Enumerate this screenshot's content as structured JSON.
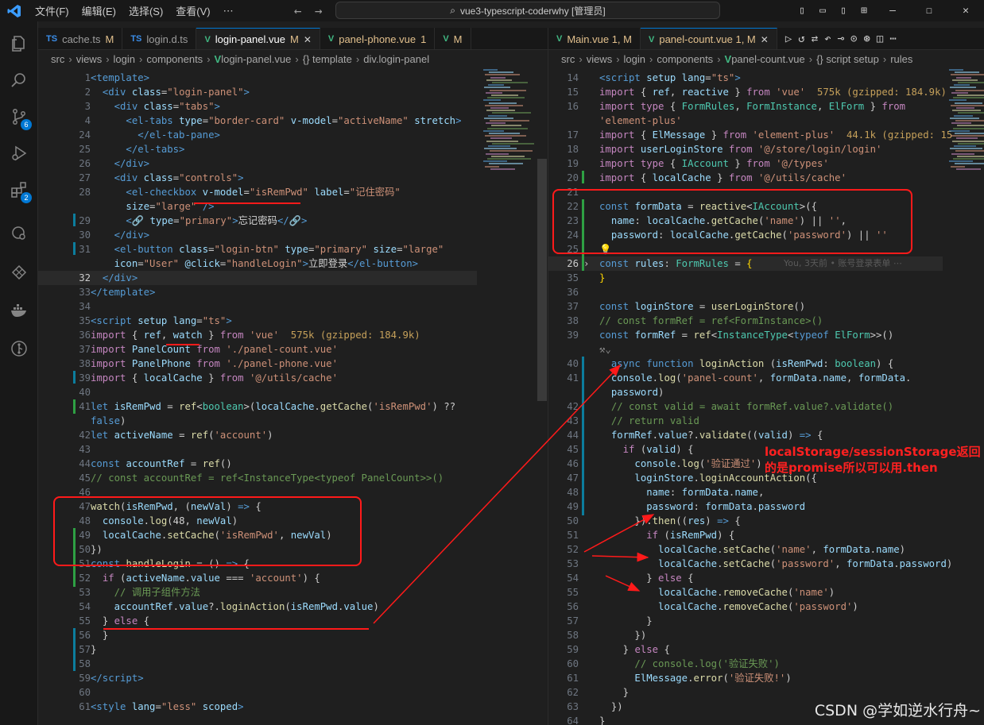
{
  "titlebar": {
    "menus": [
      "文件(F)",
      "编辑(E)",
      "选择(S)",
      "查看(V)",
      "⋯"
    ],
    "search": "vue3-typescript-coderwhy [管理员]"
  },
  "activity": {
    "scm_badge": "6",
    "extensions_badge": "2"
  },
  "left": {
    "tabs": [
      {
        "label": "cache.ts",
        "status": "M",
        "kind": "ts"
      },
      {
        "label": "login.d.ts",
        "status": "",
        "kind": "ts"
      },
      {
        "label": "login-panel.vue",
        "status": "M",
        "kind": "vue",
        "active": true
      },
      {
        "label": "panel-phone.vue",
        "status": "1",
        "kind": "vue"
      },
      {
        "label": "M",
        "status": "",
        "kind": "vue"
      }
    ],
    "breadcrumb": [
      "src",
      "views",
      "login",
      "components",
      "login-panel.vue",
      "{} template",
      "div.login-panel"
    ],
    "lines": [
      {
        "n": "1",
        "html": "<span class='tg'>&lt;template&gt;</span>"
      },
      {
        "n": "2",
        "html": "  <span class='tg'>&lt;div</span> <span class='at'>class</span><span class='pn'>=</span><span class='st'>\"login-panel\"</span><span class='tg'>&gt;</span>"
      },
      {
        "n": "3",
        "html": "    <span class='tg'>&lt;div</span> <span class='at'>class</span><span class='pn'>=</span><span class='st'>\"tabs\"</span><span class='tg'>&gt;</span>"
      },
      {
        "n": "4",
        "html": "      <span class='tg'>&lt;el-tabs</span> <span class='at'>type</span><span class='pn'>=</span><span class='st'>\"border-card\"</span> <span class='at'>v-model</span><span class='pn'>=</span><span class='st'>\"activeName\"</span> <span class='at'>stretch</span><span class='tg'>&gt;</span>"
      },
      {
        "n": "24",
        "html": "        <span class='tg'>&lt;/el-tab-pane&gt;</span>"
      },
      {
        "n": "25",
        "html": "      <span class='tg'>&lt;/el-tabs&gt;</span>"
      },
      {
        "n": "26",
        "html": "    <span class='tg'>&lt;/div&gt;</span>"
      },
      {
        "n": "27",
        "html": "    <span class='tg'>&lt;div</span> <span class='at'>class</span><span class='pn'>=</span><span class='st'>\"controls\"</span><span class='tg'>&gt;</span>"
      },
      {
        "n": "28",
        "html": "      <span class='tg'>&lt;el-checkbox</span> <span class='at'>v-model</span><span class='pn'>=</span><span class='st'>\"isRemPwd\"</span> <span class='at'>label</span><span class='pn'>=</span><span class='st'>\"记住密码\"</span>"
      },
      {
        "n": "",
        "html": "      <span class='at'>size</span><span class='pn'>=</span><span class='st'>\"large\"</span> <span class='tg'>/&gt;</span>"
      },
      {
        "n": "29",
        "html": "      <span class='tg'>&lt;🔗</span> <span class='at'>type</span><span class='pn'>=</span><span class='st'>\"primary\"</span><span class='tg'>&gt;</span><span class='wh'>忘记密码</span><span class='tg'>&lt;/🔗&gt;</span>"
      },
      {
        "n": "30",
        "html": "    <span class='tg'>&lt;/div&gt;</span>"
      },
      {
        "n": "31",
        "html": "    <span class='tg'>&lt;el-button</span> <span class='at'>class</span><span class='pn'>=</span><span class='st'>\"login-btn\"</span> <span class='at'>type</span><span class='pn'>=</span><span class='st'>\"primary\"</span> <span class='at'>size</span><span class='pn'>=</span><span class='st'>\"large\"</span>"
      },
      {
        "n": "",
        "html": "    <span class='at'>icon</span><span class='pn'>=</span><span class='st'>\"User\"</span> <span class='at'>@click</span><span class='pn'>=</span><span class='st'>\"handleLogin\"</span><span class='tg'>&gt;</span><span class='wh'>立即登录</span><span class='tg'>&lt;/el-button&gt;</span>"
      },
      {
        "n": "32",
        "html": "  <span class='tg'>&lt;/div&gt;</span>",
        "current": true
      },
      {
        "n": "33",
        "html": "<span class='tg'>&lt;/template&gt;</span>"
      },
      {
        "n": "34",
        "html": ""
      },
      {
        "n": "35",
        "html": "<span class='tg'>&lt;script</span> <span class='at'>setup</span> <span class='at'>lang</span><span class='pn'>=</span><span class='st'>\"ts\"</span><span class='tg'>&gt;</span>"
      },
      {
        "n": "36",
        "html": "<span class='kw'>import</span> <span class='pn'>{</span> <span class='va'>ref</span><span class='pn'>,</span> <span class='va'>watch</span> <span class='pn'>}</span> <span class='kw'>from</span> <span class='st'>'vue'</span>  <span class='sz'>575k (gzipped: 184.9k)</span>"
      },
      {
        "n": "37",
        "html": "<span class='kw'>import</span> <span class='va'>PanelCount</span> <span class='kw'>from</span> <span class='st'>'./panel-count.vue'</span>"
      },
      {
        "n": "38",
        "html": "<span class='kw'>import</span> <span class='va'>PanelPhone</span> <span class='kw'>from</span> <span class='st'>'./panel-phone.vue'</span>"
      },
      {
        "n": "39",
        "html": "<span class='kw'>import</span> <span class='pn'>{</span> <span class='va'>localCache</span> <span class='pn'>}</span> <span class='kw'>from</span> <span class='st'>'@/utils/cache'</span>"
      },
      {
        "n": "40",
        "html": ""
      },
      {
        "n": "41",
        "html": "<span class='sk'>let</span> <span class='va'>isRemPwd</span> <span class='pn'>=</span> <span class='fn'>ref</span><span class='pn'>&lt;</span><span class='ty'>boolean</span><span class='pn'>&gt;(</span><span class='va'>localCache</span><span class='pn'>.</span><span class='fn'>getCache</span><span class='pn'>(</span><span class='st'>'isRemPwd'</span><span class='pn'>) ??</span>"
      },
      {
        "n": "",
        "html": "<span class='bl'>false</span><span class='pn'>)</span>"
      },
      {
        "n": "42",
        "html": "<span class='sk'>let</span> <span class='va'>activeName</span> <span class='pn'>=</span> <span class='fn'>ref</span><span class='pn'>(</span><span class='st'>'account'</span><span class='pn'>)</span>"
      },
      {
        "n": "43",
        "html": ""
      },
      {
        "n": "44",
        "html": "<span class='sk'>const</span> <span class='va'>accountRef</span> <span class='pn'>=</span> <span class='fn'>ref</span><span class='pn'>()</span>"
      },
      {
        "n": "45",
        "html": "<span class='cm'>// const accountRef = ref&lt;InstanceType&lt;typeof PanelCount&gt;&gt;()</span>"
      },
      {
        "n": "46",
        "html": ""
      },
      {
        "n": "47",
        "html": "<span class='fn'>watch</span><span class='pn'>(</span><span class='va'>isRemPwd</span><span class='pn'>, (</span><span class='va'>newVal</span><span class='pn'>)</span> <span class='sk'>=&gt;</span> <span class='pn'>{</span>"
      },
      {
        "n": "48",
        "html": "  <span class='va'>console</span><span class='pn'>.</span><span class='fn'>log</span><span class='pn'>(</span><span class='wh'>48</span><span class='pn'>,</span> <span class='va'>newVal</span><span class='pn'>)</span>"
      },
      {
        "n": "49",
        "html": "  <span class='va'>localCache</span><span class='pn'>.</span><span class='fn'>setCache</span><span class='pn'>(</span><span class='st'>'isRemPwd'</span><span class='pn'>,</span> <span class='va'>newVal</span><span class='pn'>)</span>"
      },
      {
        "n": "50",
        "html": "<span class='pn'>})</span>"
      },
      {
        "n": "51",
        "html": "<span class='sk'>const</span> <span class='fn'>handleLogin</span> <span class='pn'>=</span> <span class='pn'>()</span> <span class='sk'>=&gt;</span> <span class='pn'>{</span>"
      },
      {
        "n": "52",
        "html": "  <span class='kw'>if</span> <span class='pn'>(</span><span class='va'>activeName</span><span class='pn'>.</span><span class='va'>value</span> <span class='pn'>===</span> <span class='st'>'account'</span><span class='pn'>) {</span>"
      },
      {
        "n": "53",
        "html": "    <span class='cm'>// 调用子组件方法</span>"
      },
      {
        "n": "54",
        "html": "    <span class='va'>accountRef</span><span class='pn'>.</span><span class='va'>value</span><span class='pn'>?.</span><span class='fn'>loginAction</span><span class='pn'>(</span><span class='va'>isRemPwd</span><span class='pn'>.</span><span class='va'>value</span><span class='pn'>)</span>"
      },
      {
        "n": "55",
        "html": "  <span class='pn'>}</span> <span class='kw'>else</span> <span class='pn'>{</span>"
      },
      {
        "n": "56",
        "html": "  <span class='pn'>}</span>"
      },
      {
        "n": "57",
        "html": "<span class='pn'>}</span>"
      },
      {
        "n": "58",
        "html": ""
      },
      {
        "n": "59",
        "html": "<span class='tg'>&lt;/script&gt;</span>"
      },
      {
        "n": "60",
        "html": ""
      },
      {
        "n": "61",
        "html": "<span class='tg'>&lt;style</span> <span class='at'>lang</span><span class='pn'>=</span><span class='st'>\"less\"</span> <span class='at'>scoped</span><span class='tg'>&gt;</span>"
      }
    ]
  },
  "right": {
    "tabs": [
      {
        "label": "Main.vue 1, M",
        "status": "",
        "kind": "vue"
      },
      {
        "label": "panel-count.vue 1, M",
        "status": "",
        "kind": "vue",
        "active": true
      }
    ],
    "breadcrumb": [
      "src",
      "views",
      "login",
      "components",
      "panel-count.vue",
      "{} script setup",
      "rules"
    ],
    "blame": "You, 3天前 • 账号登录表单 ⋯",
    "lines": [
      {
        "n": "14",
        "html": "<span class='tg'>&lt;script</span> <span class='at'>setup</span> <span class='at'>lang</span><span class='pn'>=</span><span class='st'>\"ts\"</span><span class='tg'>&gt;</span>"
      },
      {
        "n": "15",
        "html": "<span class='kw'>import</span> <span class='pn'>{</span> <span class='va'>ref</span><span class='pn'>,</span> <span class='va'>reactive</span> <span class='pn'>}</span> <span class='kw'>from</span> <span class='st'>'vue'</span>  <span class='sz'>575k (gzipped: 184.9k)</span>"
      },
      {
        "n": "16",
        "html": "<span class='kw'>import</span> <span class='kw'>type</span> <span class='pn'>{</span> <span class='ty'>FormRules</span><span class='pn'>,</span> <span class='ty'>FormInstance</span><span class='pn'>,</span> <span class='ty'>ElForm</span> <span class='pn'>}</span> <span class='kw'>from</span>"
      },
      {
        "n": "",
        "html": "<span class='st'>'element-plus'</span>"
      },
      {
        "n": "17",
        "html": "<span class='kw'>import</span> <span class='pn'>{</span> <span class='va'>ElMessage</span> <span class='pn'>}</span> <span class='kw'>from</span> <span class='st'>'element-plus'</span>  <span class='sz'>44.1k (gzipped: 15</span>"
      },
      {
        "n": "18",
        "html": "<span class='kw'>import</span> <span class='va'>userLoginStore</span> <span class='kw'>from</span> <span class='st'>'@/store/login/login'</span>"
      },
      {
        "n": "19",
        "html": "<span class='kw'>import</span> <span class='kw'>type</span> <span class='pn'>{</span> <span class='ty'>IAccount</span> <span class='pn'>}</span> <span class='kw'>from</span> <span class='st'>'@/types'</span>"
      },
      {
        "n": "20",
        "html": "<span class='kw'>import</span> <span class='pn'>{</span> <span class='va'>localCache</span> <span class='pn'>}</span> <span class='kw'>from</span> <span class='st'>'@/utils/cache'</span>"
      },
      {
        "n": "21",
        "html": ""
      },
      {
        "n": "22",
        "html": "<span class='sk'>const</span> <span class='va'>formData</span> <span class='pn'>=</span> <span class='fn'>reactive</span><span class='pn'>&lt;</span><span class='ty'>IAccount</span><span class='pn'>&gt;({</span>"
      },
      {
        "n": "23",
        "html": "  <span class='va'>name</span><span class='pn'>:</span> <span class='va'>localCache</span><span class='pn'>.</span><span class='fn'>getCache</span><span class='pn'>(</span><span class='st'>'name'</span><span class='pn'>) ||</span> <span class='st'>''</span><span class='pn'>,</span>"
      },
      {
        "n": "24",
        "html": "  <span class='va'>password</span><span class='pn'>:</span> <span class='va'>localCache</span><span class='pn'>.</span><span class='fn'>getCache</span><span class='pn'>(</span><span class='st'>'password'</span><span class='pn'>) ||</span> <span class='st'>''</span>"
      },
      {
        "n": "25",
        "html": "<span class='br'>💡</span>"
      },
      {
        "n": "26",
        "html": "<span class='sk'>const</span> <span class='va'>rules</span><span class='pn'>:</span> <span class='ty'>FormRules</span> <span class='pn'>=</span> <span class='br'>{</span>",
        "current": true,
        "fold": true
      },
      {
        "n": "35",
        "html": "<span class='br'>}</span>"
      },
      {
        "n": "36",
        "html": ""
      },
      {
        "n": "37",
        "html": "<span class='sk'>const</span> <span class='va'>loginStore</span> <span class='pn'>=</span> <span class='fn'>userLoginStore</span><span class='pn'>()</span>"
      },
      {
        "n": "38",
        "html": "<span class='cm'>// const formRef = ref&lt;FormInstance&gt;()</span>"
      },
      {
        "n": "39",
        "html": "<span class='sk'>const</span> <span class='va'>formRef</span> <span class='pn'>=</span> <span class='fn'>ref</span><span class='pn'>&lt;</span><span class='ty'>InstanceType</span><span class='pn'>&lt;</span><span class='sk'>typeof</span> <span class='ty'>ElForm</span><span class='pn'>&gt;&gt;()</span>"
      },
      {
        "n": "",
        "html": "<span class='gl'>⚒⌄</span>"
      },
      {
        "n": "40",
        "html": "  <span class='sk'>async</span> <span class='sk'>function</span> <span class='fn'>loginAction</span> <span class='pn'>(</span><span class='va'>isRemPwd</span><span class='pn'>:</span> <span class='ty'>boolean</span><span class='pn'>) {</span>"
      },
      {
        "n": "41",
        "html": "  <span class='va'>console</span><span class='pn'>.</span><span class='fn'>log</span><span class='pn'>(</span><span class='st'>'panel-count'</span><span class='pn'>,</span> <span class='va'>formData</span><span class='pn'>.</span><span class='va'>name</span><span class='pn'>,</span> <span class='va'>formData</span><span class='pn'>.</span>"
      },
      {
        "n": "",
        "html": "  <span class='va'>password</span><span class='pn'>)</span>"
      },
      {
        "n": "42",
        "html": "  <span class='cm'>// const valid = await formRef.value?.validate()</span>"
      },
      {
        "n": "43",
        "html": "  <span class='cm'>// return valid</span>"
      },
      {
        "n": "44",
        "html": "  <span class='va'>formRef</span><span class='pn'>.</span><span class='va'>value</span><span class='pn'>?.</span><span class='fn'>validate</span><span class='pn'>((</span><span class='va'>valid</span><span class='pn'>)</span> <span class='sk'>=&gt;</span> <span class='pn'>{</span>"
      },
      {
        "n": "45",
        "html": "    <span class='kw'>if</span> <span class='pn'>(</span><span class='va'>valid</span><span class='pn'>) {</span>"
      },
      {
        "n": "46",
        "html": "      <span class='va'>console</span><span class='pn'>.</span><span class='fn'>log</span><span class='pn'>(</span><span class='st'>'验证通过'</span><span class='pn'>)</span>"
      },
      {
        "n": "47",
        "html": "      <span class='va'>loginStore</span><span class='pn'>.</span><span class='fn'>loginAccountAction</span><span class='pn'>({</span>"
      },
      {
        "n": "48",
        "html": "        <span class='va'>name</span><span class='pn'>:</span> <span class='va'>formData</span><span class='pn'>.</span><span class='va'>name</span><span class='pn'>,</span>"
      },
      {
        "n": "49",
        "html": "        <span class='va'>password</span><span class='pn'>:</span> <span class='va'>formData</span><span class='pn'>.</span><span class='va'>password</span>"
      },
      {
        "n": "50",
        "html": "      <span class='pn'>}).</span><span class='fn'>then</span><span class='pn'>((</span><span class='va'>res</span><span class='pn'>)</span> <span class='sk'>=&gt;</span> <span class='pn'>{</span>"
      },
      {
        "n": "51",
        "html": "        <span class='kw'>if</span> <span class='pn'>(</span><span class='va'>isRemPwd</span><span class='pn'>) {</span>"
      },
      {
        "n": "52",
        "html": "          <span class='va'>localCache</span><span class='pn'>.</span><span class='fn'>setCache</span><span class='pn'>(</span><span class='st'>'name'</span><span class='pn'>,</span> <span class='va'>formData</span><span class='pn'>.</span><span class='va'>name</span><span class='pn'>)</span>"
      },
      {
        "n": "53",
        "html": "          <span class='va'>localCache</span><span class='pn'>.</span><span class='fn'>setCache</span><span class='pn'>(</span><span class='st'>'password'</span><span class='pn'>,</span> <span class='va'>formData</span><span class='pn'>.</span><span class='va'>password</span><span class='pn'>)</span>"
      },
      {
        "n": "54",
        "html": "        <span class='pn'>}</span> <span class='kw'>else</span> <span class='pn'>{</span>"
      },
      {
        "n": "55",
        "html": "          <span class='va'>localCache</span><span class='pn'>.</span><span class='fn'>removeCache</span><span class='pn'>(</span><span class='st'>'name'</span><span class='pn'>)</span>"
      },
      {
        "n": "56",
        "html": "          <span class='va'>localCache</span><span class='pn'>.</span><span class='fn'>removeCache</span><span class='pn'>(</span><span class='st'>'password'</span><span class='pn'>)</span>"
      },
      {
        "n": "57",
        "html": "        <span class='pn'>}</span>"
      },
      {
        "n": "58",
        "html": "      <span class='pn'>})</span>"
      },
      {
        "n": "59",
        "html": "    <span class='pn'>}</span> <span class='kw'>else</span> <span class='pn'>{</span>"
      },
      {
        "n": "60",
        "html": "      <span class='cm'>// console.log('验证失败')</span>"
      },
      {
        "n": "61",
        "html": "      <span class='va'>ElMessage</span><span class='pn'>.</span><span class='fn'>error</span><span class='pn'>(</span><span class='st'>'验证失败!'</span><span class='pn'>)</span>"
      },
      {
        "n": "62",
        "html": "    <span class='pn'>}</span>"
      },
      {
        "n": "63",
        "html": "  <span class='pn'>})</span>"
      },
      {
        "n": "64",
        "html": "<span class='pn'>}</span>"
      }
    ]
  },
  "annotation": {
    "note_line1": "localStorage/sessionStorage返回",
    "note_line2": "的是promise所以可以用.then"
  },
  "watermark": "CSDN @学如逆水行舟~",
  "colors": {
    "accent": "#0078d4",
    "annotation": "#ff1a1a"
  }
}
